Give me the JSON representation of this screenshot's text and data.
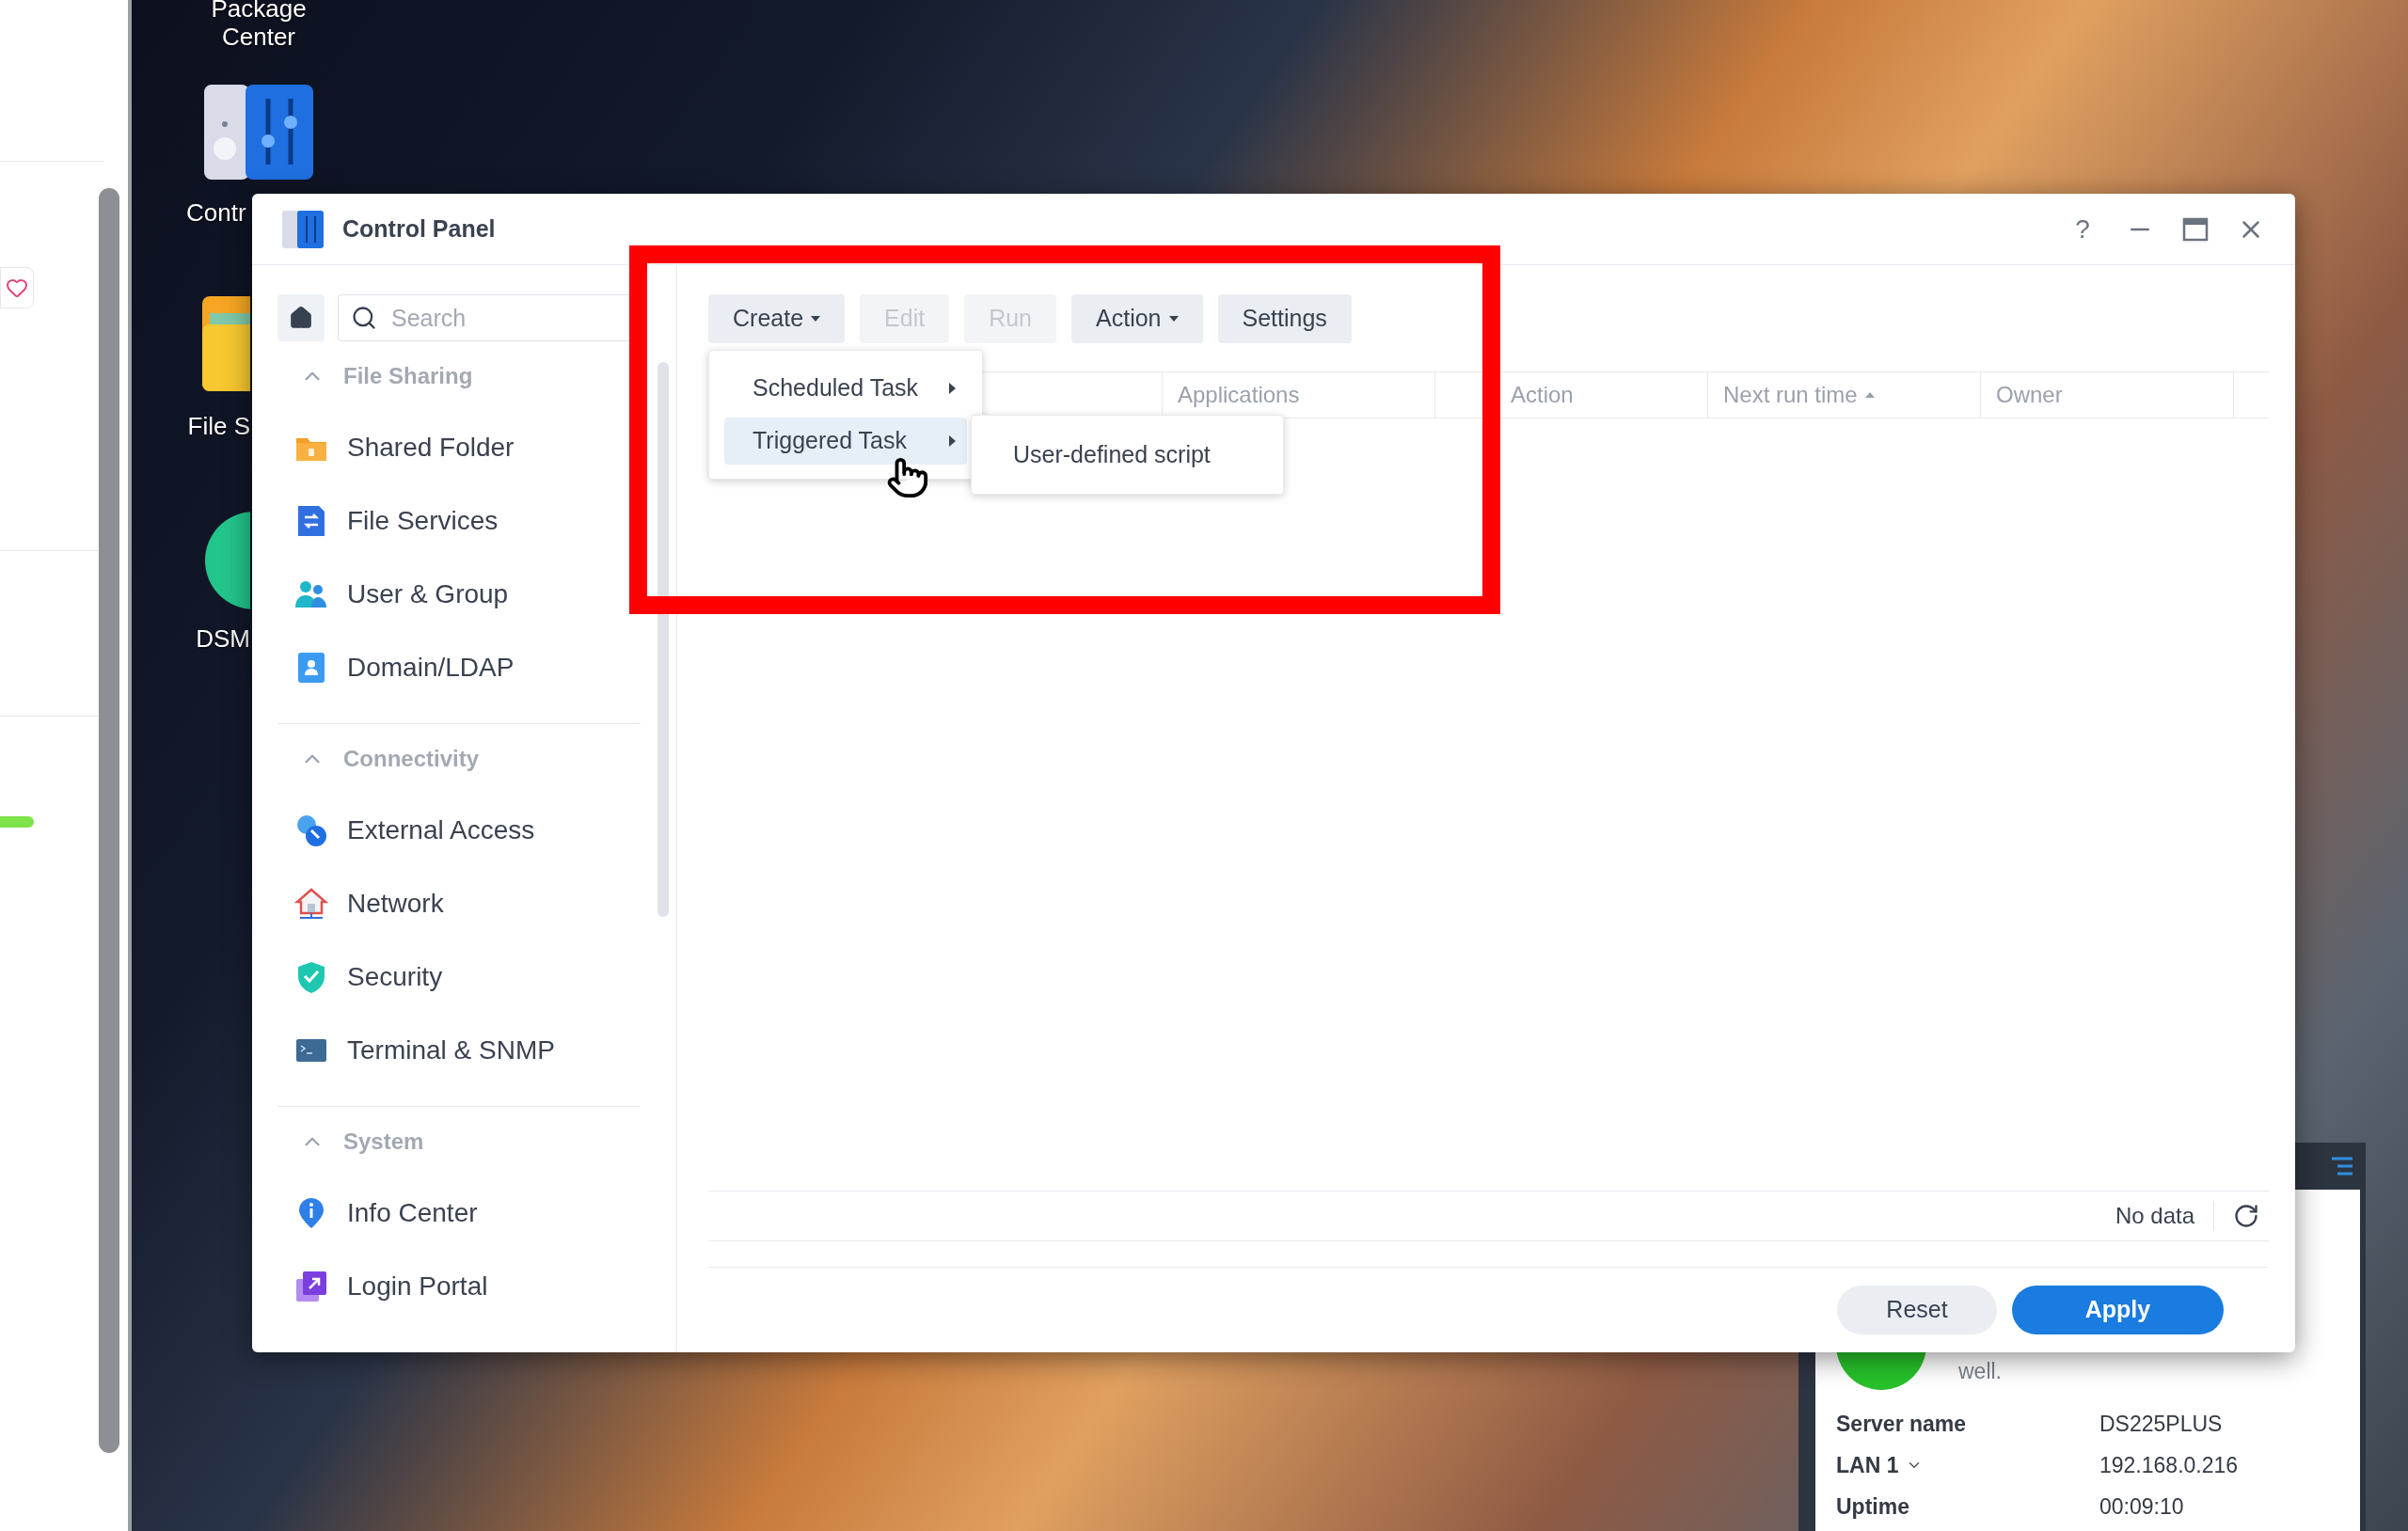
{
  "desktop_icons": [
    {
      "label": "Package Center",
      "kind": "none"
    },
    {
      "label": "Contr",
      "kind": "control"
    },
    {
      "label": "File S",
      "kind": "folder"
    },
    {
      "label": "DSM",
      "kind": "dsm"
    }
  ],
  "window": {
    "title": "Control Panel",
    "help_glyph": "?"
  },
  "sidebar": {
    "search": {
      "placeholder": "Search"
    },
    "groups": [
      {
        "title": "File Sharing",
        "expanded": true,
        "items": [
          {
            "label": "Shared Folder",
            "kind": "folder"
          },
          {
            "label": "File Services",
            "kind": "services"
          },
          {
            "label": "User & Group",
            "kind": "users"
          },
          {
            "label": "Domain/LDAP",
            "kind": "domain"
          }
        ]
      },
      {
        "title": "Connectivity",
        "expanded": true,
        "items": [
          {
            "label": "External Access",
            "kind": "external"
          },
          {
            "label": "Network",
            "kind": "network"
          },
          {
            "label": "Security",
            "kind": "shield"
          },
          {
            "label": "Terminal & SNMP",
            "kind": "terminal"
          }
        ]
      },
      {
        "title": "System",
        "expanded": true,
        "items": [
          {
            "label": "Info Center",
            "kind": "info"
          },
          {
            "label": "Login Portal",
            "kind": "portal"
          }
        ]
      }
    ]
  },
  "toolbar": [
    {
      "label": "Create",
      "disabled": false,
      "dropdown": true
    },
    {
      "label": "Edit",
      "disabled": true,
      "dropdown": false
    },
    {
      "label": "Run",
      "disabled": true,
      "dropdown": false
    },
    {
      "label": "Action",
      "disabled": false,
      "dropdown": true
    },
    {
      "label": "Settings",
      "disabled": false,
      "dropdown": false
    }
  ],
  "menu": {
    "items": [
      {
        "label": "Scheduled Task",
        "selected": false,
        "submenu": true
      },
      {
        "label": "Triggered Task",
        "selected": true,
        "submenu": true
      }
    ]
  },
  "submenu": {
    "items": [
      {
        "label": "User-defined script"
      }
    ]
  },
  "table": {
    "columns": [
      {
        "label": "Applications",
        "sorted": false
      },
      {
        "label": "Action",
        "sorted": false
      },
      {
        "label": "Next run time",
        "sorted": true
      },
      {
        "label": "Owner",
        "sorted": false
      }
    ],
    "status": "No data"
  },
  "buttons": [
    {
      "label": "Reset",
      "kind": "secondary"
    },
    {
      "label": "Apply",
      "kind": "primary"
    }
  ],
  "widget": {
    "status_text": "well.",
    "rows": [
      {
        "label": "Server name",
        "value": "DS225PLUS"
      },
      {
        "label": "LAN 1",
        "value": "192.168.0.216",
        "dropdown": true
      },
      {
        "label": "Uptime",
        "value": "00:09:10"
      }
    ]
  }
}
